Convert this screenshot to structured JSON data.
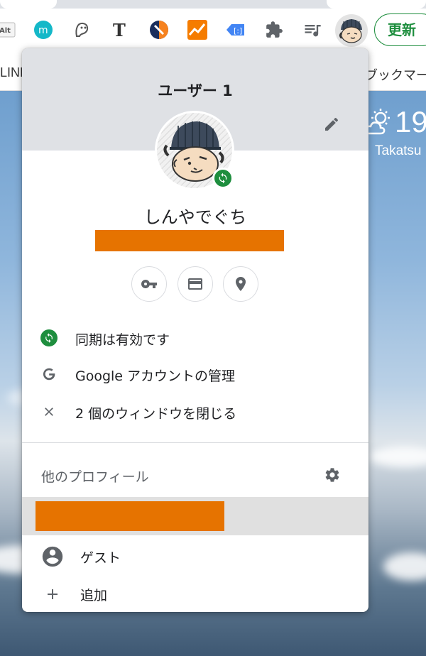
{
  "toolbar": {
    "update_label": "更新",
    "extension_icons": [
      "alt-text-icon",
      "m-circle-icon",
      "ghost-icon",
      "t-icon",
      "half-circle-icon",
      "chart-icon",
      "tag-icon",
      "puzzle-icon",
      "playlist-icon"
    ]
  },
  "bookmarks": {
    "left_text": "LINE",
    "right_text": "ブックマー"
  },
  "weather": {
    "temp": "19",
    "city": "Takatsu"
  },
  "popup": {
    "title": "ユーザー 1",
    "name": "しんやでぐち",
    "menu": [
      {
        "label": "同期は有効です",
        "icon": "sync-icon"
      },
      {
        "label": "Google アカウントの管理",
        "icon": "google-g-icon"
      },
      {
        "label": "2 個のウィンドウを閉じる",
        "icon": "close-icon"
      }
    ],
    "other_profiles_title": "他のプロフィール",
    "guest_label": "ゲスト",
    "add_label": "追加"
  },
  "colors": {
    "sync_green": "#1e8e3e",
    "redaction": "#e67300",
    "header_gray": "#dfe1e5",
    "icon_gray": "#5f6368"
  }
}
